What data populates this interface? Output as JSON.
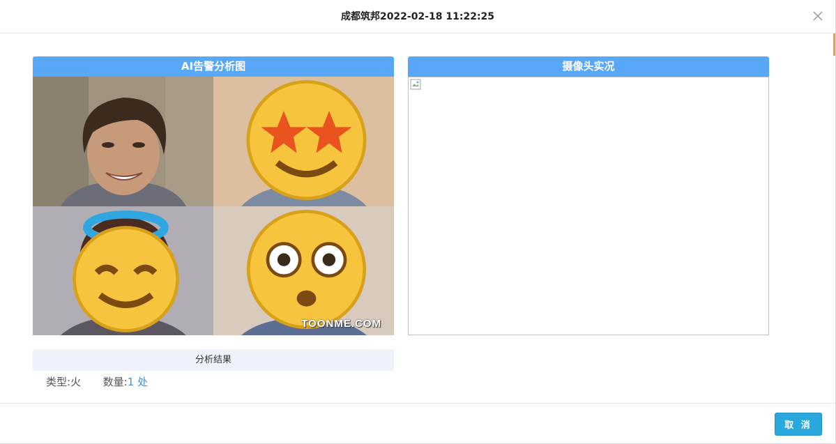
{
  "dialog": {
    "title": "成都筑邦2022-02-18 11:22:25"
  },
  "left_panel": {
    "title": "AI告警分析图",
    "watermark": "TOONME.COM",
    "images": [
      {
        "label": "real-face"
      },
      {
        "label": "cartoon-face-star-eyes",
        "emoji": "star-struck-emoji"
      },
      {
        "label": "cartoon-face-angel",
        "emoji": "halo-emoji"
      },
      {
        "label": "cartoon-face-surprised",
        "emoji": "flushed-emoji"
      }
    ]
  },
  "right_panel": {
    "title": "摄像头实况"
  },
  "analysis": {
    "bar_label": "分析结果",
    "type_label": "类型:",
    "type_value": "火",
    "count_label": "数量:",
    "count_value": "1 处"
  },
  "footer": {
    "cancel_label": "取 消"
  },
  "colors": {
    "panel_header": "#59a8f8",
    "cancel_button": "#28a8dc",
    "quantity_text": "#3d8fe0",
    "result_bar": "#eef3fb"
  }
}
